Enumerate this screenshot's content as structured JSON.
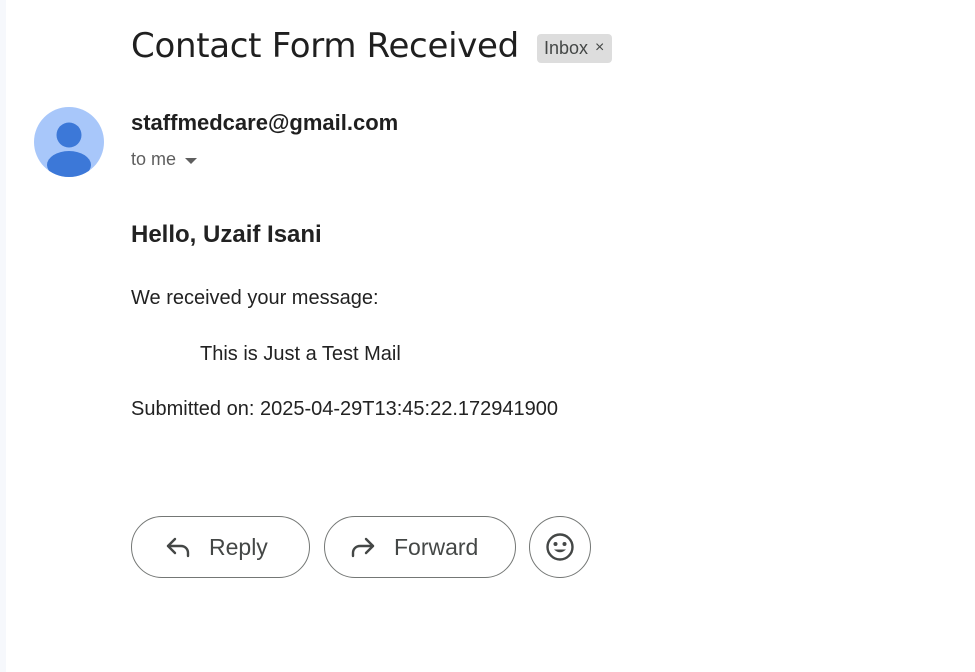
{
  "email": {
    "subject": "Contact Form Received",
    "label": {
      "text": "Inbox",
      "remove_symbol": "×"
    },
    "sender": {
      "address": "staffmedcare@gmail.com",
      "avatar_icon": "default-person-avatar"
    },
    "recipient_text": "to me",
    "body": {
      "greeting": "Hello, Uzaif Isani",
      "intro": "We received your message:",
      "message": "This is Just a Test Mail",
      "submitted": "Submitted on: 2025-04-29T13:45:22.172941900"
    }
  },
  "actions": {
    "reply_label": "Reply",
    "forward_label": "Forward",
    "reply_icon": "reply-arrow-icon",
    "forward_icon": "forward-arrow-icon",
    "emoji_icon": "smiley-face-icon"
  },
  "colors": {
    "avatar_bg": "#a8c7fa",
    "avatar_fg": "#3c78d8",
    "chip_bg": "#dddddd",
    "button_border": "#747775"
  }
}
